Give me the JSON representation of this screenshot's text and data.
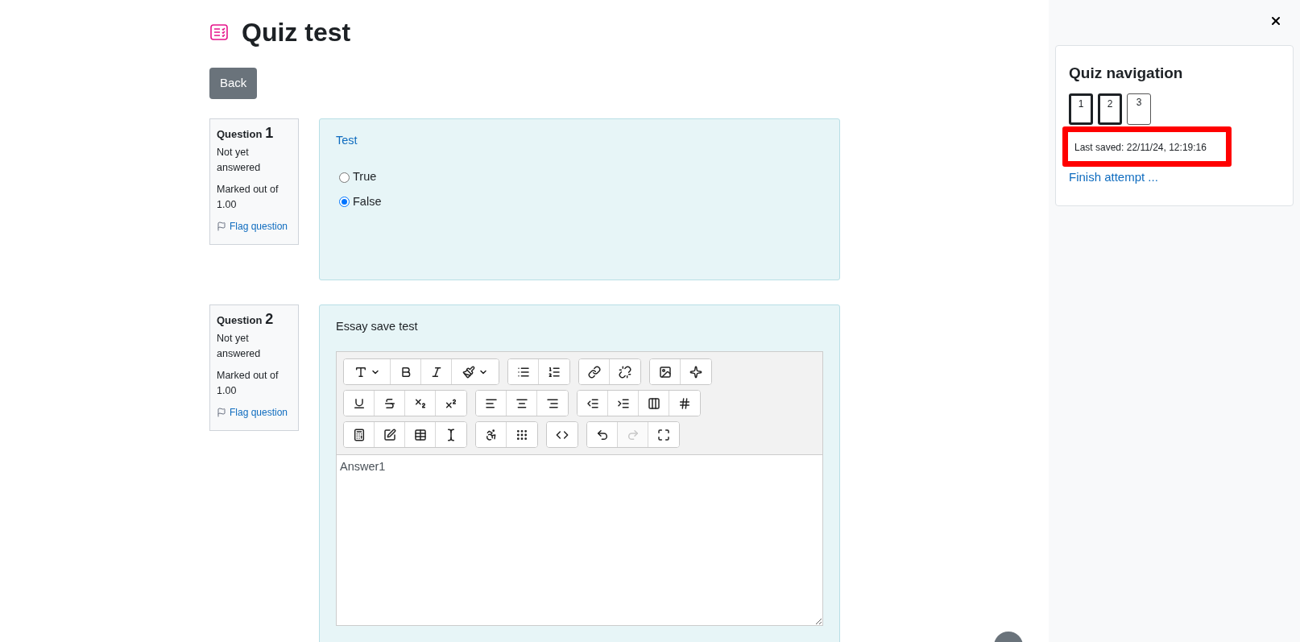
{
  "page": {
    "title": "Quiz test",
    "back_button": "Back"
  },
  "questions": [
    {
      "label": "Question",
      "number": "1",
      "status": "Not yet answered",
      "marks": "Marked out of 1.00",
      "flag": "Flag question",
      "kind": "truefalse",
      "prompt": "Test",
      "options": [
        {
          "label": "True",
          "selected": false
        },
        {
          "label": "False",
          "selected": true
        }
      ]
    },
    {
      "label": "Question",
      "number": "2",
      "status": "Not yet answered",
      "marks": "Marked out of 1.00",
      "flag": "Flag question",
      "kind": "essay",
      "prompt": "Essay save test",
      "answer": "Answer1",
      "toolbar": [
        [
          [
            {
              "disabled": false
            },
            {
              "disabled": false
            },
            {
              "disabled": false
            },
            {
              "disabled": false
            }
          ],
          [
            {
              "disabled": false
            },
            {
              "disabled": false
            }
          ],
          [
            {
              "disabled": false
            },
            {
              "disabled": false
            }
          ],
          [
            {
              "disabled": false
            },
            {
              "disabled": false
            }
          ]
        ],
        [
          [
            {
              "disabled": false
            },
            {
              "disabled": false
            },
            {
              "disabled": false
            },
            {
              "disabled": false
            }
          ],
          [
            {
              "disabled": false
            },
            {
              "disabled": false
            },
            {
              "disabled": false
            }
          ],
          [
            {
              "disabled": false
            },
            {
              "disabled": false
            },
            {
              "disabled": false
            },
            {
              "disabled": false
            }
          ]
        ],
        [
          [
            {
              "disabled": false
            },
            {
              "disabled": false
            },
            {
              "disabled": false
            },
            {
              "disabled": false
            }
          ],
          [
            {
              "disabled": false
            },
            {
              "disabled": false
            }
          ],
          [
            {
              "disabled": false
            }
          ],
          [
            {
              "disabled": false
            },
            {
              "disabled": true
            },
            {
              "disabled": false
            }
          ]
        ]
      ]
    }
  ],
  "navigation": {
    "title": "Quiz navigation",
    "buttons": [
      {
        "label": "1",
        "current": true
      },
      {
        "label": "2",
        "current": true
      },
      {
        "label": "3",
        "current": false
      }
    ],
    "last_saved": "Last saved: 22/11/24, 12:19:16",
    "highlighted": true,
    "finish": "Finish attempt ..."
  }
}
